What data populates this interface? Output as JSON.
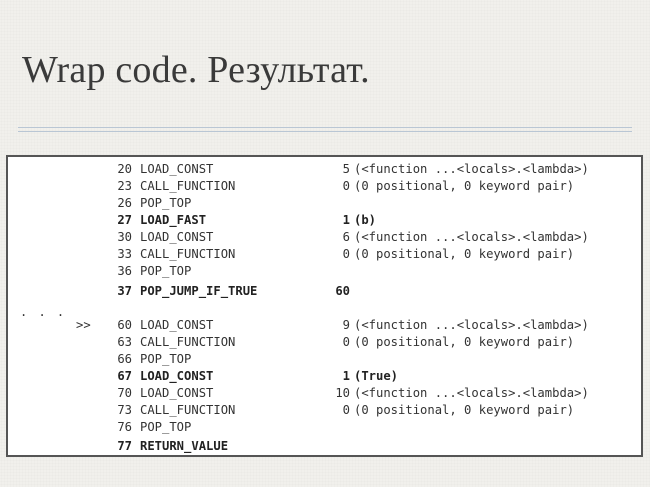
{
  "slide": {
    "title": "Wrap code. Результат."
  },
  "code": {
    "ellipsis": ". . .",
    "lines": [
      {
        "marker": "",
        "offset": "20",
        "op": "LOAD_CONST",
        "arg": "5",
        "repr": "(<function ...<locals>.<lambda>)",
        "bold": false
      },
      {
        "marker": "",
        "offset": "23",
        "op": "CALL_FUNCTION",
        "arg": "0",
        "repr": "(0 positional, 0 keyword pair)",
        "bold": false
      },
      {
        "marker": "",
        "offset": "26",
        "op": "POP_TOP",
        "arg": "",
        "repr": "",
        "bold": false
      },
      {
        "marker": "",
        "offset": "27",
        "op": "LOAD_FAST",
        "arg": "1",
        "repr": "(b)",
        "bold": true
      },
      {
        "marker": "",
        "offset": "30",
        "op": "LOAD_CONST",
        "arg": "6",
        "repr": "(<function ...<locals>.<lambda>)",
        "bold": false
      },
      {
        "marker": "",
        "offset": "33",
        "op": "CALL_FUNCTION",
        "arg": "0",
        "repr": "(0 positional, 0 keyword pair)",
        "bold": false
      },
      {
        "marker": "",
        "offset": "36",
        "op": "POP_TOP",
        "arg": "",
        "repr": "",
        "bold": false
      },
      {
        "marker": "",
        "offset": "37",
        "op": "POP_JUMP_IF_TRUE",
        "arg": "60",
        "repr": "",
        "bold": true
      },
      {
        "marker": ">>",
        "offset": "60",
        "op": "LOAD_CONST",
        "arg": "9",
        "repr": "(<function ...<locals>.<lambda>)",
        "bold": false
      },
      {
        "marker": "",
        "offset": "63",
        "op": "CALL_FUNCTION",
        "arg": "0",
        "repr": "(0 positional, 0 keyword pair)",
        "bold": false
      },
      {
        "marker": "",
        "offset": "66",
        "op": "POP_TOP",
        "arg": "",
        "repr": "",
        "bold": false
      },
      {
        "marker": "",
        "offset": "67",
        "op": "LOAD_CONST",
        "arg": "1",
        "repr": "(True)",
        "bold": true
      },
      {
        "marker": "",
        "offset": "70",
        "op": "LOAD_CONST",
        "arg": "10",
        "repr": "(<function ...<locals>.<lambda>)",
        "bold": false
      },
      {
        "marker": "",
        "offset": "73",
        "op": "CALL_FUNCTION",
        "arg": "0",
        "repr": "(0 positional, 0 keyword pair)",
        "bold": false
      },
      {
        "marker": "",
        "offset": "76",
        "op": "POP_TOP",
        "arg": "",
        "repr": "",
        "bold": false
      },
      {
        "marker": "",
        "offset": "77",
        "op": "RETURN_VALUE",
        "arg": "",
        "repr": "",
        "bold": true
      }
    ]
  }
}
